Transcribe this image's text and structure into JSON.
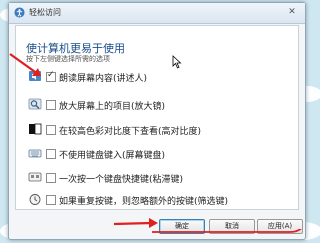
{
  "window": {
    "title": "轻松访问",
    "close_glyph": "✕"
  },
  "content": {
    "heading": "使计算机更易于使用",
    "subtext": "按下左侧键选择所需的选项"
  },
  "options": [
    {
      "label": "朗读屏幕内容(讲述人)",
      "checked": true,
      "icon": "narrator-icon"
    },
    {
      "label": "放大屏幕上的项目(放大镜)",
      "checked": false,
      "icon": "magnifier-icon"
    },
    {
      "label": "在较高色彩对比度下查看(高对比度)",
      "checked": false,
      "icon": "high-contrast-icon"
    },
    {
      "label": "不使用键盘键入(屏幕键盘)",
      "checked": false,
      "icon": "on-screen-keyboard-icon"
    },
    {
      "label": "一次按一个键盘快捷键(粘滞键)",
      "checked": false,
      "icon": "sticky-keys-icon"
    },
    {
      "label": "如果重复按键，则忽略额外的按键(筛选键)",
      "checked": false,
      "icon": "filter-keys-icon"
    }
  ],
  "buttons": {
    "ok": "确定",
    "cancel": "取消",
    "apply": "应用(A)"
  },
  "colors": {
    "annotation": "#e0201e",
    "heading": "#1a4f8a"
  }
}
